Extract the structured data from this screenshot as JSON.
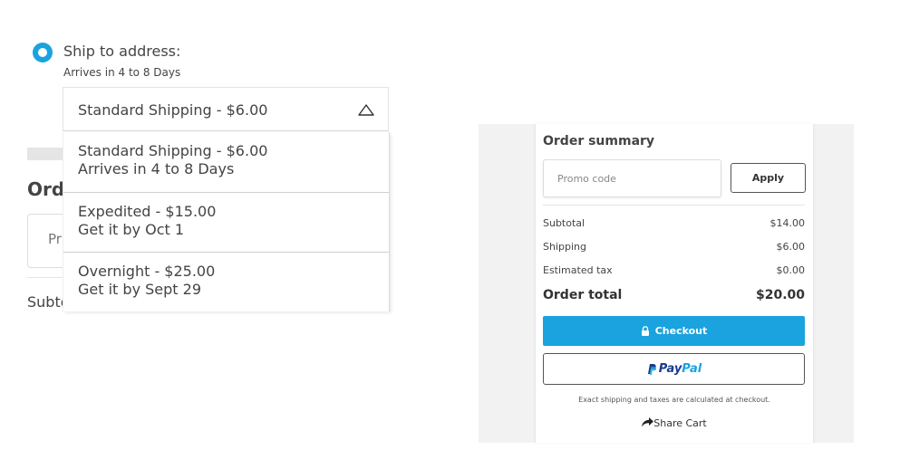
{
  "shipping": {
    "option_label": "Ship to address:",
    "option_sub": "Arrives in 4 to 8 Days",
    "selected": "Standard Shipping - $6.00",
    "options": [
      {
        "title": "Standard Shipping - $6.00",
        "detail": "Arrives in 4 to 8 Days"
      },
      {
        "title": "Expedited - $15.00",
        "detail": "Get it by Oct 1"
      },
      {
        "title": "Overnight - $25.00",
        "detail": "Get it by Sept 29"
      }
    ]
  },
  "background": {
    "order_heading_partial": "Ord",
    "promo_partial": "Pr",
    "subtotal_partial": "Subto"
  },
  "summary": {
    "title": "Order summary",
    "promo_placeholder": "Promo code",
    "apply_label": "Apply",
    "rows": [
      {
        "label": "Subtotal",
        "value": "$14.00"
      },
      {
        "label": "Shipping",
        "value": "$6.00"
      },
      {
        "label": "Estimated tax",
        "value": "$0.00"
      }
    ],
    "total_label": "Order total",
    "total_value": "$20.00",
    "checkout_label": "Checkout",
    "paypal_text_a": "Pay",
    "paypal_text_b": "Pal",
    "note": "Exact shipping and taxes are calculated at checkout.",
    "share_label": "Share Cart"
  },
  "colors": {
    "accent": "#1aa3de",
    "paypal_dark": "#1a3a8c",
    "text": "#444444"
  },
  "icons": {
    "radio": "radio-selected-icon",
    "caret": "caret-up-icon",
    "lock": "lock-icon",
    "paypal": "paypal-logo-icon",
    "share": "share-arrow-icon"
  }
}
